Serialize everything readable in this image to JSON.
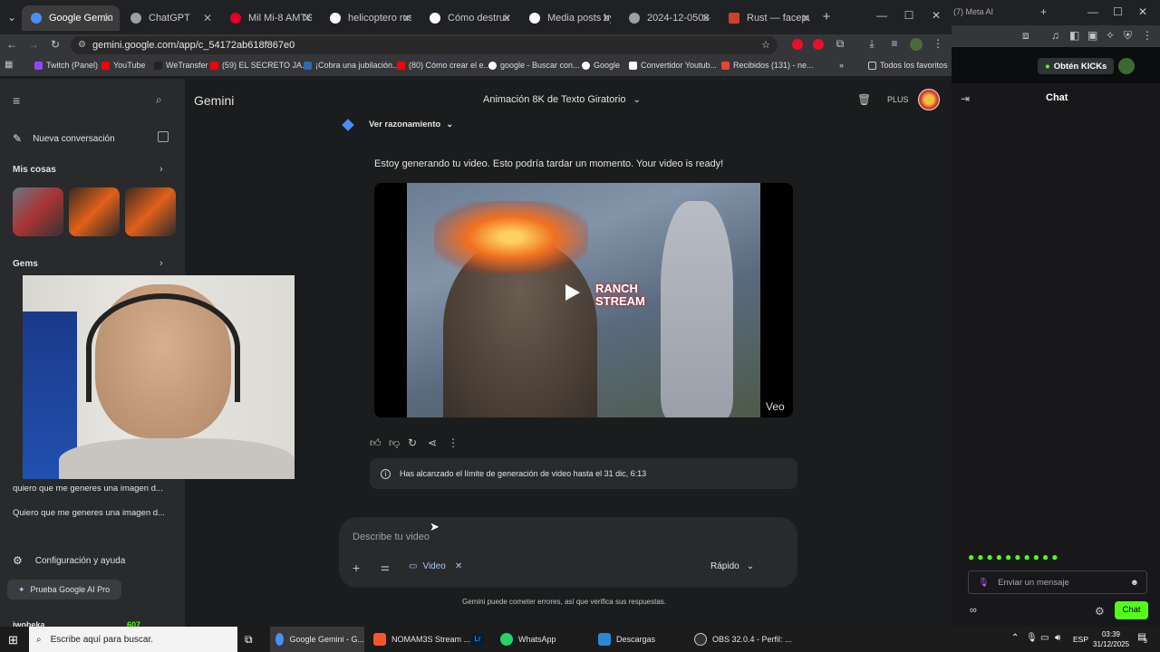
{
  "browser": {
    "tabs": [
      {
        "label": "Google Gemini",
        "color": "#4a8ef7"
      },
      {
        "label": "ChatGPT",
        "color": "#9aa0a6"
      },
      {
        "label": "Mil Mi-8 AMTSh",
        "color": "#e60023"
      },
      {
        "label": "helicoptero rust",
        "color": "#ffffff"
      },
      {
        "label": "Cómo destruir he",
        "color": "#ffffff"
      },
      {
        "label": "Media posts by R",
        "color": "#ffffff"
      },
      {
        "label": "2024-12-0508-52",
        "color": "#9aa0a6"
      },
      {
        "label": "Rust — facepunc",
        "color": "#cd412b"
      }
    ],
    "url": "gemini.google.com/app/c_54172ab618f867e0",
    "bookmarks": [
      {
        "label": "Twitch (Panel)",
        "color": "#9146ff"
      },
      {
        "label": "YouTube",
        "color": "#ff0000"
      },
      {
        "label": "WeTransfer",
        "color": "#222222"
      },
      {
        "label": "(59) EL SECRETO JA...",
        "color": "#ff0000"
      },
      {
        "label": "¡Cobra una jubilación...",
        "color": "#2b6cb0"
      },
      {
        "label": "(80) Cómo crear el e...",
        "color": "#ff0000"
      },
      {
        "label": "google - Buscar con...",
        "color": "#ffffff"
      },
      {
        "label": "Google",
        "color": "#ffffff"
      },
      {
        "label": "Convertidor Youtub...",
        "color": "#ffffff"
      },
      {
        "label": "Recibidos (131) - ne...",
        "color": "#ea4335"
      }
    ],
    "all_bookmarks": "Todos los favoritos"
  },
  "sidebar": {
    "new_chat": "Nueva conversación",
    "my_stuff": "Mis cosas",
    "gems": "Gems",
    "recents": [
      "quiero que me generes una imagen d...",
      "Quiero que me generes una imagen d..."
    ],
    "settings": "Configuración y ayuda",
    "try_pro": "Prueba Google AI Pro",
    "bottom_user": "iwobeka",
    "bottom_count": "607"
  },
  "header": {
    "app_name": "Gemini",
    "conversation_title": "Animación 8K de Texto Giratorio",
    "plan": "PLUS"
  },
  "chat": {
    "reasoning_toggle": "Ver razonamiento",
    "response_text": "Estoy generando tu video. Esto podría tardar un momento. Your video is ready!",
    "video_overlay_text": "RANCH\nSTREAM",
    "video_badge": "Veo",
    "limit_notice": "Has alcanzado el límite de generación de video hasta el 31 dic, 6:13"
  },
  "composer": {
    "placeholder": "Describe tu video",
    "tool_chip": "Video",
    "mode": "Rápido"
  },
  "footer_notice": "Gemini puede cometer errores, así que verifica sus respuestas.",
  "right_panel": {
    "top_title": "(7) Meta AI",
    "kick_button": "Obtén KICKs",
    "chat_title": "Chat",
    "message_placeholder": "Enviar un mensaje",
    "chat_button": "Chat",
    "infinity": "∞"
  },
  "taskbar": {
    "search": "Escribe aquí para buscar.",
    "apps": [
      {
        "label": "Google Gemini - G...",
        "color": "#4a8ef7"
      },
      {
        "label": "NOMAM3S Stream ...",
        "color": "#fb542b"
      },
      {
        "label": "",
        "color": "#001e36"
      },
      {
        "label": "WhatsApp",
        "color": "#25d366"
      },
      {
        "label": "Descargas",
        "color": "#2b88d8"
      },
      {
        "label": "OBS 32.0.4 - Perfil: ...",
        "color": "#333333"
      }
    ],
    "lang": "ESP",
    "time": "03:39",
    "date": "31/12/2025",
    "notifications": "9"
  },
  "colors": {
    "accent_blue": "#a8c7fa",
    "kick_green": "#53fc18"
  }
}
